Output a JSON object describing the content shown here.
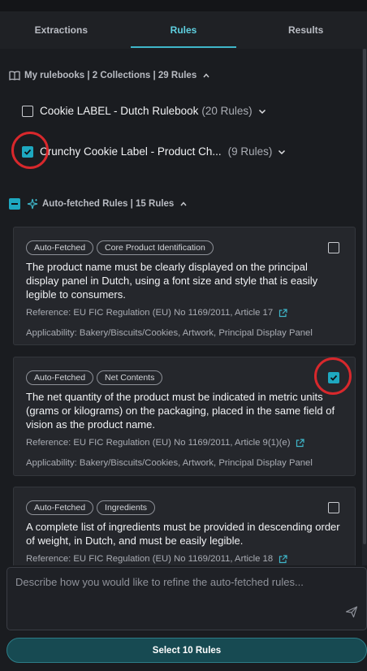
{
  "tabs": [
    {
      "label": "Extractions",
      "active": false
    },
    {
      "label": "Rules",
      "active": true
    },
    {
      "label": "Results",
      "active": false
    }
  ],
  "rulebooks": {
    "header": "My rulebooks | 2 Collections | 29 Rules",
    "items": [
      {
        "name": "Cookie LABEL - Dutch Rulebook",
        "count": "(20 Rules)",
        "checked": false
      },
      {
        "name": "Crunchy Cookie Label - Product Ch...",
        "count": "(9 Rules)",
        "checked": true
      }
    ]
  },
  "auto_fetched": {
    "header": "Auto-fetched Rules | 15 Rules",
    "cards": [
      {
        "tags": [
          "Auto-Fetched",
          "Core Product Identification"
        ],
        "text": "The product name must be clearly displayed on the principal display panel in Dutch, using a font size and style that is easily legible to consumers.",
        "reference": "Reference: EU FIC Regulation (EU) No 1169/2011, Article 17",
        "applicability": "Applicability: Bakery/Biscuits/Cookies, Artwork, Principal Display Panel",
        "checked": false
      },
      {
        "tags": [
          "Auto-Fetched",
          "Net Contents"
        ],
        "text": "The net quantity of the product must be indicated in metric units (grams or kilograms) on the packaging, placed in the same field of vision as the product name.",
        "reference": "Reference: EU FIC Regulation (EU) No 1169/2011, Article 9(1)(e)",
        "applicability": "Applicability: Bakery/Biscuits/Cookies, Artwork, Principal Display Panel",
        "checked": true
      },
      {
        "tags": [
          "Auto-Fetched",
          "Ingredients"
        ],
        "text": "A complete list of ingredients must be provided in descending order of weight, in Dutch, and must be easily legible.",
        "reference": "Reference: EU FIC Regulation (EU) No 1169/2011, Article 18",
        "applicability": "",
        "checked": false
      }
    ]
  },
  "composer": {
    "placeholder": "Describe how you would like to refine the auto-fetched rules..."
  },
  "select_button": "Select 10 Rules",
  "colors": {
    "accent": "#1ea8c0",
    "tab_active": "#5fd0e0",
    "annotation_circle": "#d8282c",
    "button_bg": "#174a52"
  }
}
